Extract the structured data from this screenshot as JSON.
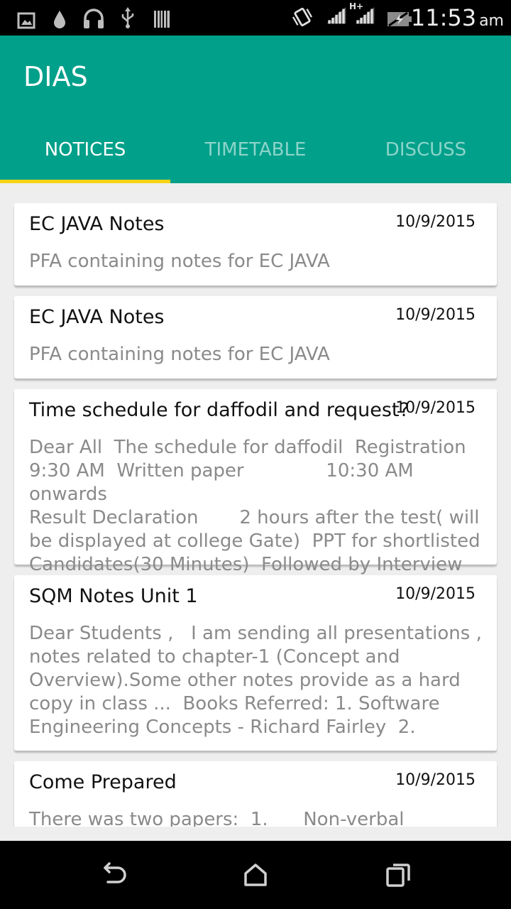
{
  "status_bar": {
    "time": "11:53",
    "ampm": "am",
    "icons": [
      "image-icon",
      "water-drop-icon",
      "headphones-icon",
      "usb-icon",
      "barcode-icon",
      "vibrate-icon",
      "signal-hplus-icon",
      "signal-icon",
      "battery-charging-icon"
    ],
    "network_type": "H+"
  },
  "app_bar": {
    "title": "DIAS",
    "background": "#00a08a",
    "tabs": [
      {
        "label": "NOTICES",
        "active": true
      },
      {
        "label": "TIMETABLE",
        "active": false
      },
      {
        "label": "DISCUSS",
        "active": false
      }
    ],
    "indicator_color": "#f7d318"
  },
  "notices": [
    {
      "title": "EC JAVA Notes",
      "date": "10/9/2015",
      "body": "PFA containing notes for EC JAVA"
    },
    {
      "title": "EC JAVA Notes",
      "date": "10/9/2015",
      "body": "PFA containing notes for EC JAVA"
    },
    {
      "title": "Time schedule for daffodil and request?",
      "date": "10/9/2015",
      "body": "Dear All  The schedule for daffodil  Registration\n9:30 AM  Written paper              10:30 AM onwards\nResult Declaration       2 hours after the test( will\nbe displayed at college Gate)  PPT for shortlisted\nCandidates(30 Minutes)  Followed by Interview"
    },
    {
      "title": "SQM Notes Unit 1",
      "date": "10/9/2015",
      "body": "Dear Students ,   I am sending all presentations ,\nnotes related to chapter-1 (Concept and\nOverview).Some other notes provide as a hard\ncopy in class ...  Books Referred: 1. Software\nEngineering Concepts - Richard Fairley  2."
    },
    {
      "title": "Come Prepared",
      "date": "10/9/2015",
      "body": "There was two papers:  1.      Non-verbal"
    }
  ],
  "nav_bar": {
    "buttons": [
      "back-icon",
      "home-icon",
      "recents-icon"
    ]
  }
}
